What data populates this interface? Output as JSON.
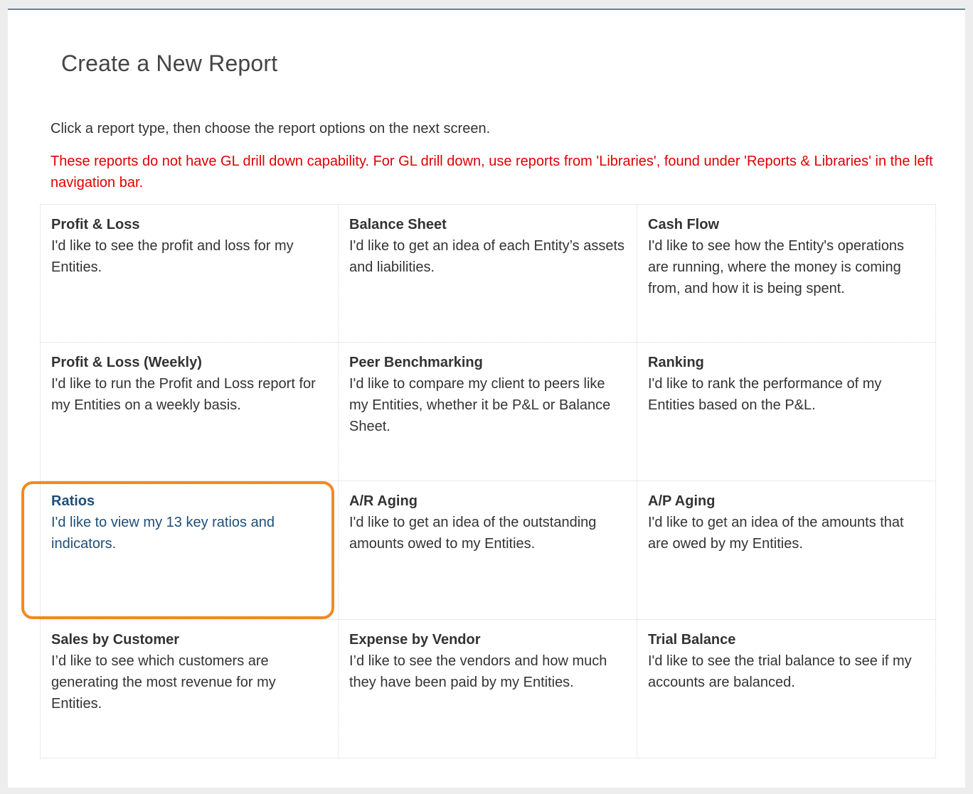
{
  "page": {
    "title": "Create a New Report",
    "intro": "Click a report type, then choose the report options on the next screen.",
    "warning": "These reports do not have GL drill down capability. For GL drill down, use reports from 'Libraries', found under 'Reports & Libraries' in the left navigation bar."
  },
  "reports": [
    {
      "title": "Profit & Loss",
      "desc": "I'd like to see the profit and loss for my Entities."
    },
    {
      "title": "Balance Sheet",
      "desc": "I'd like to get an idea of each Entity’s assets and liabilities."
    },
    {
      "title": "Cash Flow",
      "desc": "I'd like to see how the Entity's operations are running, where the money is coming from, and how it is being spent."
    },
    {
      "title": "Profit & Loss (Weekly)",
      "desc": "I'd like to run the Profit and Loss report for my Entities on a weekly basis."
    },
    {
      "title": "Peer Benchmarking",
      "desc": "I'd like to compare my client to peers like my Entities, whether it be P&L or Balance Sheet."
    },
    {
      "title": "Ranking",
      "desc": "I'd like to rank the performance of my Entities based on the P&L."
    },
    {
      "title": "Ratios",
      "desc": "I'd like to view my 13 key ratios and indicators."
    },
    {
      "title": "A/R Aging",
      "desc": "I'd like to get an idea of the outstanding amounts owed to my Entities."
    },
    {
      "title": "A/P Aging",
      "desc": "I'd like to get an idea of the amounts that are owed by my Entities."
    },
    {
      "title": "Sales by Customer",
      "desc": "I’d like to see which customers are generating the most revenue for my Entities."
    },
    {
      "title": "Expense by Vendor",
      "desc": "I’d like to see the vendors and how much they have been paid by my Entities."
    },
    {
      "title": "Trial Balance",
      "desc": "I'd like to see the trial balance to see if my accounts are balanced."
    }
  ],
  "colors": {
    "accent_highlight": "#f08a24",
    "active_text": "#1f4e79",
    "warning_text": "#e00000"
  }
}
